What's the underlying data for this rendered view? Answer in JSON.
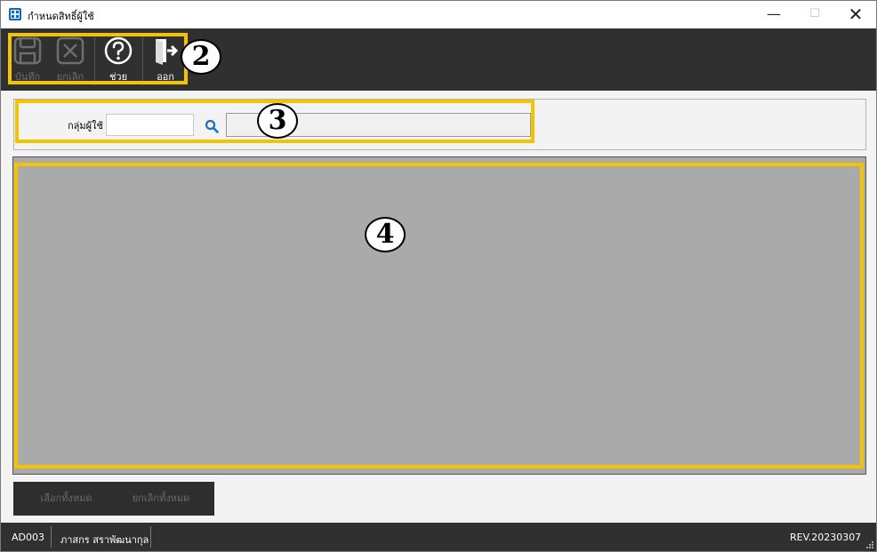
{
  "window": {
    "title": "กำหนดสิทธิ์ผู้ใช้",
    "minimize_glyph": "—",
    "maximize_glyph": "☐",
    "close_glyph": "✕"
  },
  "toolbar": {
    "save_label": "บันทึก",
    "cancel_label": "ยกเลิก",
    "help_label": "ช่วย",
    "exit_label": "ออก"
  },
  "filter": {
    "group_label": "กลุ่มผู้ใช้",
    "group_code_value": "",
    "group_name_value": ""
  },
  "buttons": {
    "select_all_label": "เลือกทั้งหมด",
    "deselect_all_label": "ยกเลิกทั้งหมด"
  },
  "status": {
    "program_code": "AD003",
    "user_name": "ภาสกร สราพัฒนากุล",
    "revision": "REV.20230307"
  },
  "annotations": {
    "toolbar_callout": "2",
    "filter_callout": "3",
    "grid_callout": "4",
    "highlight_color": "#f5c400"
  },
  "colors": {
    "toolbar_bg": "#303030",
    "grid_bg": "#aaaaaa",
    "search_icon": "#1a6fc4"
  }
}
